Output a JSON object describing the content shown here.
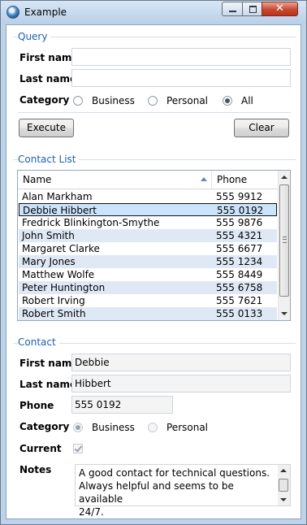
{
  "window": {
    "title": "Example"
  },
  "query": {
    "group_title": "Query",
    "first_name_label": "First name",
    "first_name_value": "",
    "last_name_label": "Last name",
    "last_name_value": "",
    "category_label": "Category",
    "options": [
      "Business",
      "Personal",
      "All"
    ],
    "selected_option": "All",
    "execute_label": "Execute",
    "clear_label": "Clear"
  },
  "contact_list": {
    "group_title": "Contact List",
    "columns": [
      "Name",
      "Phone"
    ],
    "sort_column": "Name",
    "sort_direction": "ascending",
    "selected_row": 1,
    "rows": [
      {
        "name": "Alan Markham",
        "phone": "555 9912"
      },
      {
        "name": "Debbie Hibbert",
        "phone": "555 0192"
      },
      {
        "name": "Fredrick Blinkington-Smythe",
        "phone": "555 9876"
      },
      {
        "name": "John Smith",
        "phone": "555 4321"
      },
      {
        "name": "Margaret Clarke",
        "phone": "555 6677"
      },
      {
        "name": "Mary Jones",
        "phone": "555 1234"
      },
      {
        "name": "Matthew Wolfe",
        "phone": "555 8449"
      },
      {
        "name": "Peter Huntington",
        "phone": "555 6758"
      },
      {
        "name": "Robert Irving",
        "phone": "555 7621"
      },
      {
        "name": "Robert Smith",
        "phone": "555 0133"
      }
    ]
  },
  "contact": {
    "group_title": "Contact",
    "first_name_label": "First name",
    "first_name_value": "Debbie",
    "last_name_label": "Last name",
    "last_name_value": "Hibbert",
    "phone_label": "Phone",
    "phone_value": "555 0192",
    "category_label": "Category",
    "options": [
      "Business",
      "Personal"
    ],
    "selected_option": "Business",
    "current_label": "Current",
    "current_checked": true,
    "notes_label": "Notes",
    "notes_lines": [
      "A good contact for technical questions.",
      "Always helpful and seems to be available",
      "24/7."
    ]
  }
}
